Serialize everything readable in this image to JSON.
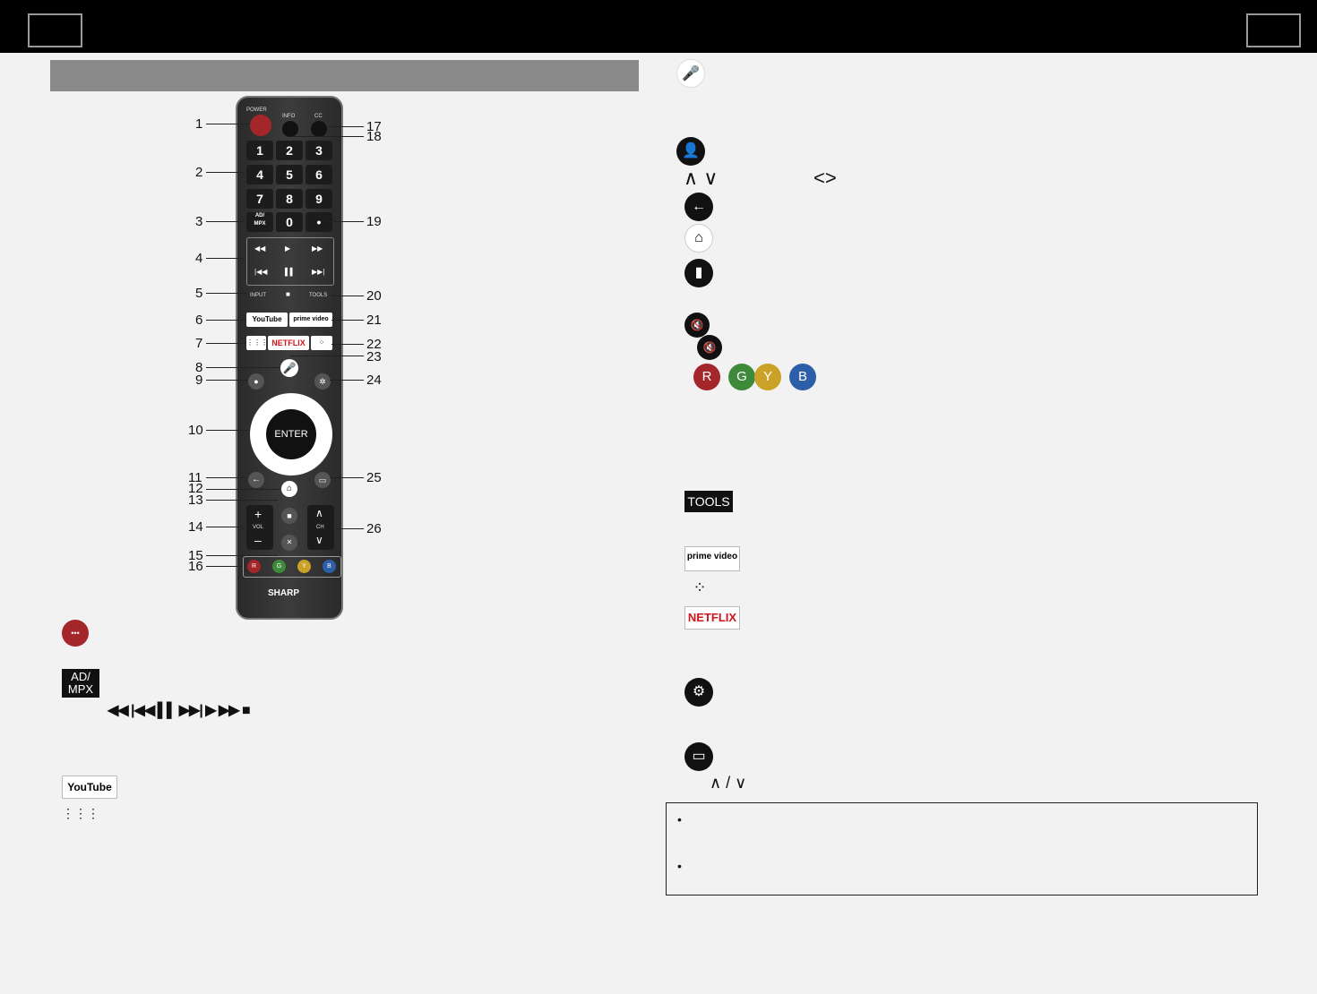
{
  "remote": {
    "power_label": "POWER",
    "info_label": "INFO",
    "cc_label": "CC",
    "keys_row1": [
      "1",
      "2",
      "3"
    ],
    "keys_row2": [
      "4",
      "5",
      "6"
    ],
    "keys_row3": [
      "7",
      "8",
      "9"
    ],
    "admpx_label": "AD/\nMPX",
    "zero_label": "0",
    "dot_label": "•",
    "input_label": "INPUT",
    "tools_label": "TOOLS",
    "youtube_label": "YouTube",
    "prime_label": "prime video",
    "netflix_label": "NETFLIX",
    "enter_label": "ENTER",
    "vol_label": "VOL",
    "ch_label": "CH",
    "brand_label": "SHARP",
    "color_keys": [
      "R",
      "G",
      "Y",
      "B"
    ]
  },
  "callouts_left": [
    "1",
    "2",
    "3",
    "4",
    "5",
    "6",
    "7",
    "8",
    "9",
    "10",
    "11",
    "12",
    "13",
    "14",
    "15",
    "16"
  ],
  "callouts_right": [
    "17",
    "18",
    "19",
    "20",
    "21",
    "22",
    "23",
    "24",
    "25",
    "26"
  ],
  "legend": {
    "admpx": "AD/\nMPX",
    "transport": "◀◀ |◀◀ ▌▌ ▶▶|  ▶ ▶▶  ■",
    "youtube": "YouTube",
    "tools": "TOOLS",
    "prime": "prime video",
    "netflix": "NETFLIX",
    "color_keys": [
      "R",
      "G",
      "Y",
      "B"
    ],
    "updown": "∧ ∨",
    "leftright": "<>",
    "ch_updown": "∧ / ∨"
  },
  "notes": [
    "•",
    "•"
  ],
  "colors": {
    "red": "#a3262a",
    "green": "#3f8a3a",
    "yellow": "#c9a227",
    "blue": "#2d5fa8"
  }
}
